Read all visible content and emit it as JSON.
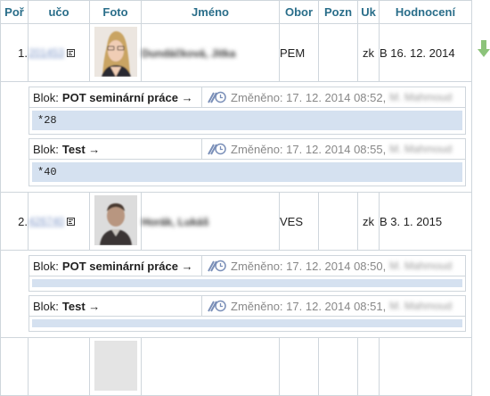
{
  "header": {
    "col_poradi": "Poř",
    "col_uco": "učo",
    "col_foto": "Foto",
    "col_jmeno": "Jméno",
    "col_obor": "Obor",
    "col_pozn": "Pozn",
    "col_uk": "Uk",
    "col_hodnoceni": "Hodnocení"
  },
  "students": [
    {
      "poradi": "1.",
      "uco": "201453",
      "jmeno": "Dundáčková, Jitka",
      "obor": "PEM",
      "pozn": "",
      "uk": "zk",
      "hodnoceni": "B 16. 12. 2014",
      "blocks": [
        {
          "prefix": "Blok:",
          "name": "POT seminární práce →",
          "changed_label": "Změněno:",
          "changed": "17. 12. 2014 08:52,",
          "changed_by": "M. Mahmoud",
          "note": "*28"
        },
        {
          "prefix": "Blok:",
          "name": "Test →",
          "changed_label": "Změněno:",
          "changed": "17. 12. 2014 08:55,",
          "changed_by": "M. Mahmoud",
          "note": "*40"
        }
      ]
    },
    {
      "poradi": "2.",
      "uco": "426740",
      "jmeno": "Horák, Lukáš",
      "obor": "VES",
      "pozn": "",
      "uk": "zk",
      "hodnoceni": "B 3. 1. 2015",
      "blocks": [
        {
          "prefix": "Blok:",
          "name": "POT seminární práce →",
          "changed_label": "Změněno:",
          "changed": "17. 12. 2014 08:50,",
          "changed_by": "M. Mahmoud",
          "note": ""
        },
        {
          "prefix": "Blok:",
          "name": "Test →",
          "changed_label": "Změněno:",
          "changed": "17. 12. 2014 08:51,",
          "changed_by": "M. Mahmoud",
          "note": ""
        }
      ]
    }
  ],
  "colors": {
    "header_text": "#2a6e8a",
    "note_bg": "#d5e1f0",
    "border": "#cfd6dc",
    "arrow": "#8cc37a"
  },
  "icons": {
    "contact": "contact-card-icon",
    "meta": "edit-history-icon",
    "arrow": "arrow-down-icon"
  }
}
